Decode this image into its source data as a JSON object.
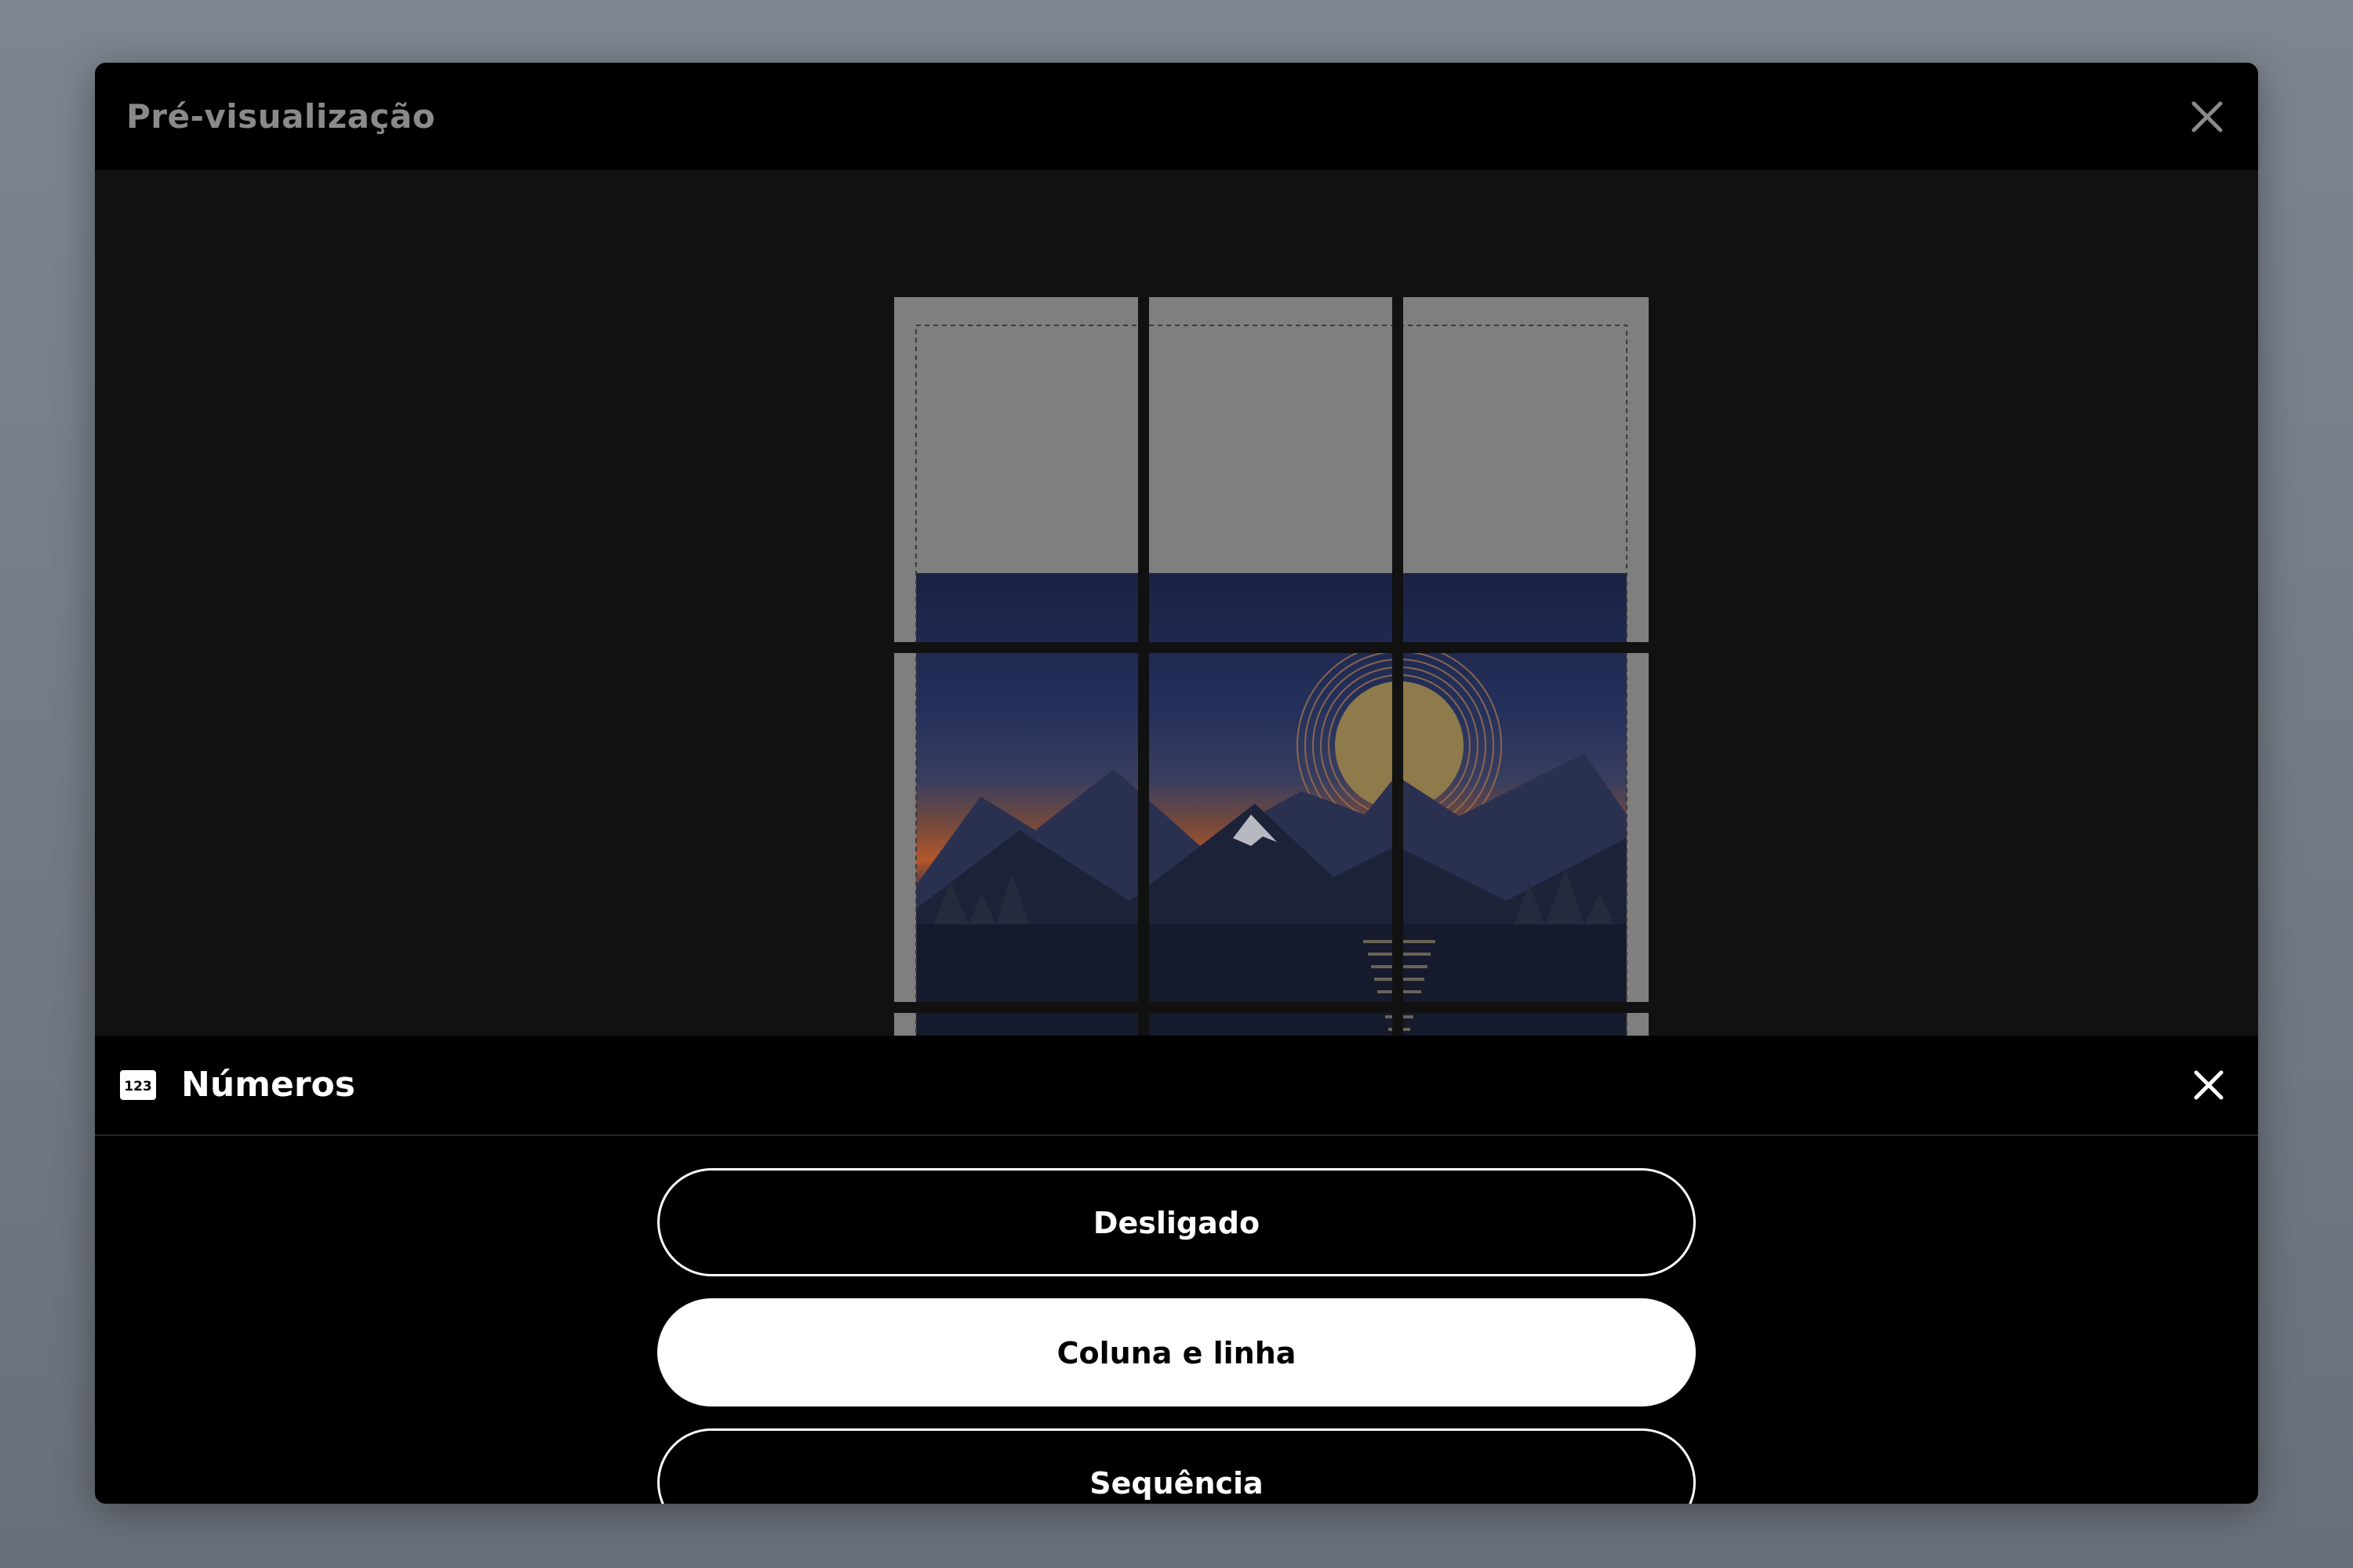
{
  "modal": {
    "title": "Pré-visualização"
  },
  "panel": {
    "title": "Números",
    "icon_text": "123"
  },
  "options": [
    {
      "label": "Desligado",
      "selected": false
    },
    {
      "label": "Coluna e linha",
      "selected": true
    },
    {
      "label": "Sequência",
      "selected": false
    }
  ],
  "icons": {
    "header_close": "close-icon",
    "panel_close": "close-icon",
    "panel_icon": "numbers-icon"
  },
  "colors": {
    "modal_bg": "#111111",
    "header_bg": "#000000",
    "frame_gray": "#808080",
    "moon": "#8e7a4a",
    "sky_top": "#1b2246",
    "sky_sunset": "#b3572a"
  }
}
